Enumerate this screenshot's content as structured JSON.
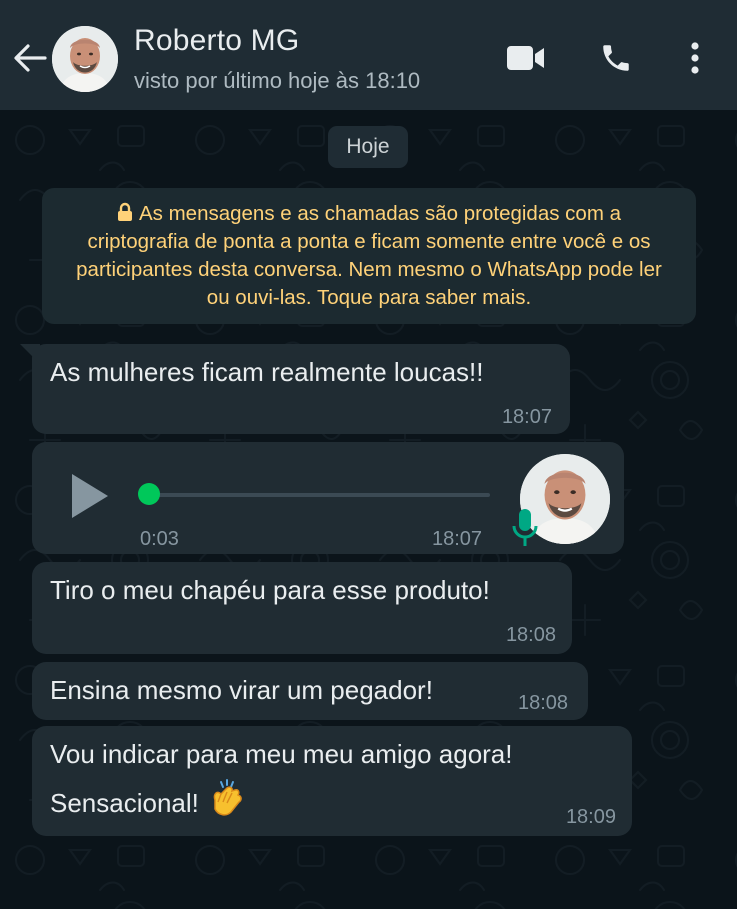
{
  "header": {
    "contact_name": "Roberto MG",
    "status": "visto por último hoje às 18:10",
    "icons": [
      "back-arrow-icon",
      "video-call-icon",
      "phone-icon",
      "more-vert-icon"
    ]
  },
  "chat": {
    "date_chip": "Hoje",
    "encryption_notice": "As mensagens e as chamadas são protegidas com a criptografia de ponta a ponta e ficam somente entre você e os participantes desta conversa. Nem mesmo o WhatsApp pode ler ou ouvi-las. Toque para saber mais.",
    "messages": [
      {
        "type": "text",
        "lines": [
          "As mulheres ficam realmente loucas!!"
        ],
        "time": "18:07"
      },
      {
        "type": "voice",
        "duration": "0:03",
        "time": "18:07",
        "progress": 0
      },
      {
        "type": "text",
        "lines": [
          "Tiro o meu chapéu para esse produto!"
        ],
        "time": "18:08"
      },
      {
        "type": "text",
        "lines": [
          "Ensina mesmo virar um pegador!"
        ],
        "time": "18:08"
      },
      {
        "type": "text",
        "lines": [
          "Vou indicar para meu meu amigo agora!",
          "Sensacional!"
        ],
        "emoji": "clapping-hands",
        "time": "18:09"
      }
    ]
  },
  "colors": {
    "header_bg": "#1f2c34",
    "chat_bg": "#0b141a",
    "bubble_bg": "#202c33",
    "encryption_text": "#ffd279",
    "voice_dot": "#00c85a",
    "mic": "#00a884"
  }
}
